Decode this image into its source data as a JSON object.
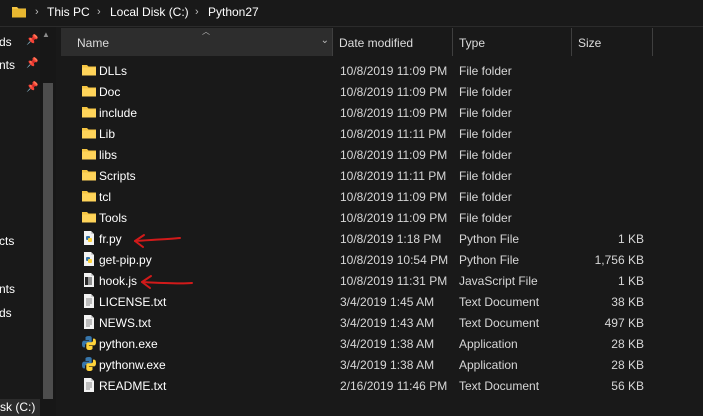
{
  "breadcrumb": {
    "items": [
      "This PC",
      "Local Disk (C:)",
      "Python27"
    ]
  },
  "nav_pane": {
    "items": [
      {
        "label": "ds",
        "pinned": true
      },
      {
        "label": "nts",
        "pinned": true
      },
      {
        "label": "",
        "pinned": true
      },
      {
        "label": "cts",
        "pinned": false
      },
      {
        "label": "nts",
        "pinned": false
      },
      {
        "label": "ds",
        "pinned": false
      }
    ],
    "drive_label": "sk (C:)"
  },
  "columns": {
    "name": "Name",
    "date": "Date modified",
    "type": "Type",
    "size": "Size"
  },
  "files": [
    {
      "name": "DLLs",
      "date": "10/8/2019 11:09 PM",
      "type": "File folder",
      "size": "",
      "icon": "folder-icon"
    },
    {
      "name": "Doc",
      "date": "10/8/2019 11:09 PM",
      "type": "File folder",
      "size": "",
      "icon": "folder-icon"
    },
    {
      "name": "include",
      "date": "10/8/2019 11:09 PM",
      "type": "File folder",
      "size": "",
      "icon": "folder-icon"
    },
    {
      "name": "Lib",
      "date": "10/8/2019 11:11 PM",
      "type": "File folder",
      "size": "",
      "icon": "folder-icon"
    },
    {
      "name": "libs",
      "date": "10/8/2019 11:09 PM",
      "type": "File folder",
      "size": "",
      "icon": "folder-icon"
    },
    {
      "name": "Scripts",
      "date": "10/8/2019 11:11 PM",
      "type": "File folder",
      "size": "",
      "icon": "folder-icon"
    },
    {
      "name": "tcl",
      "date": "10/8/2019 11:09 PM",
      "type": "File folder",
      "size": "",
      "icon": "folder-icon"
    },
    {
      "name": "Tools",
      "date": "10/8/2019 11:09 PM",
      "type": "File folder",
      "size": "",
      "icon": "folder-icon"
    },
    {
      "name": "fr.py",
      "date": "10/8/2019 1:18 PM",
      "type": "Python File",
      "size": "1 KB",
      "icon": "python-file-icon"
    },
    {
      "name": "get-pip.py",
      "date": "10/8/2019 10:54 PM",
      "type": "Python File",
      "size": "1,756 KB",
      "icon": "python-file-icon"
    },
    {
      "name": "hook.js",
      "date": "10/8/2019 11:31 PM",
      "type": "JavaScript File",
      "size": "1 KB",
      "icon": "javascript-file-icon"
    },
    {
      "name": "LICENSE.txt",
      "date": "3/4/2019 1:45 AM",
      "type": "Text Document",
      "size": "38 KB",
      "icon": "text-file-icon"
    },
    {
      "name": "NEWS.txt",
      "date": "3/4/2019 1:43 AM",
      "type": "Text Document",
      "size": "497 KB",
      "icon": "text-file-icon"
    },
    {
      "name": "python.exe",
      "date": "3/4/2019 1:38 AM",
      "type": "Application",
      "size": "28 KB",
      "icon": "python-app-icon"
    },
    {
      "name": "pythonw.exe",
      "date": "3/4/2019 1:38 AM",
      "type": "Application",
      "size": "28 KB",
      "icon": "python-app-icon"
    },
    {
      "name": "README.txt",
      "date": "2/16/2019 11:46 PM",
      "type": "Text Document",
      "size": "56 KB",
      "icon": "text-file-icon"
    }
  ],
  "annotations": [
    {
      "target": "fr.py",
      "color": "#d11a1a",
      "kind": "red-arrow"
    },
    {
      "target": "hook.js",
      "color": "#d11a1a",
      "kind": "red-arrow"
    }
  ],
  "colors": {
    "background": "#191919",
    "folder": "#f5c542",
    "annotation": "#d11a1a"
  }
}
